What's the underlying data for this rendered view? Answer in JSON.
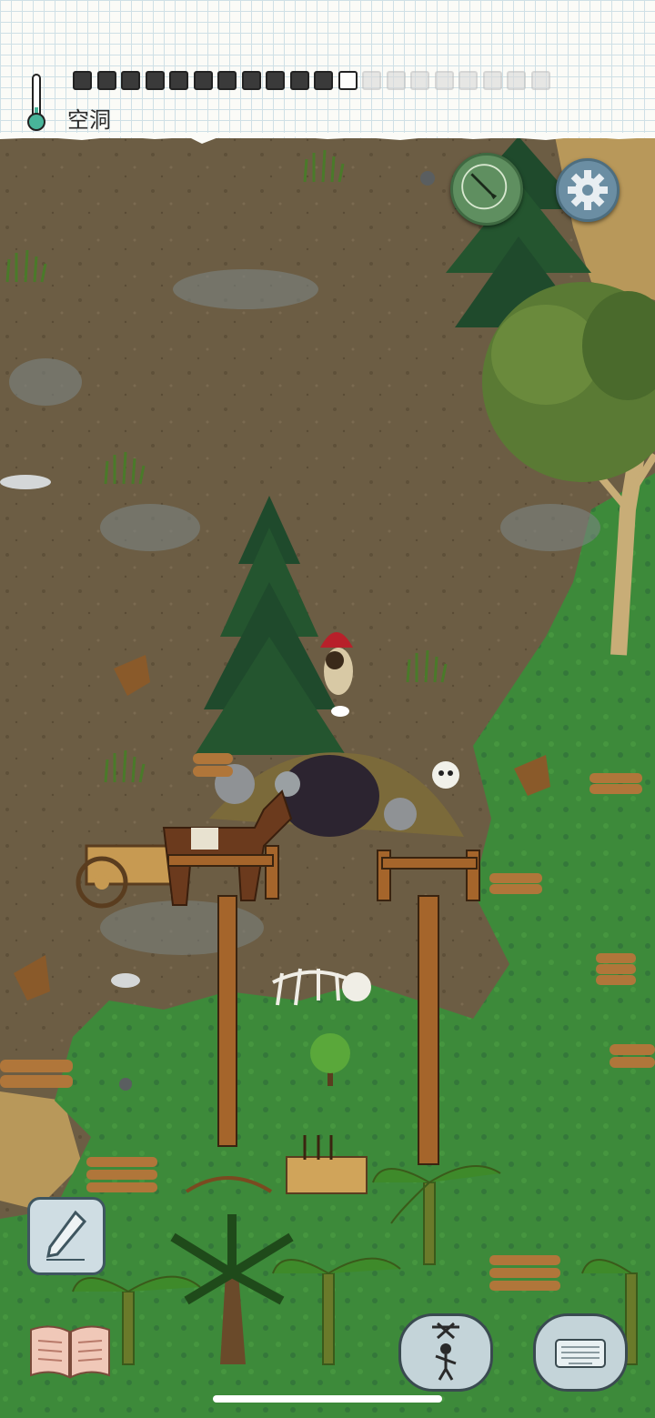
{
  "hud": {
    "status_label": "空洞",
    "hunger_pips": [
      "full",
      "full",
      "full",
      "full",
      "full",
      "full",
      "full",
      "full",
      "full",
      "full",
      "full",
      "empty",
      "faded",
      "faded",
      "faded",
      "faded",
      "faded",
      "faded",
      "faded",
      "faded"
    ],
    "temperature_level": 0.25
  },
  "buttons": {
    "compass_icon": "compass-icon",
    "settings_icon": "gear-icon",
    "note_icon": "pencil-icon",
    "tech_tree_icon": "book-icon",
    "emote_icon": "puppet-icon",
    "chat_icon": "keyboard-icon"
  },
  "colors": {
    "dirt": "#6e5f45",
    "grass": "#3f8a3c",
    "hud_paper": "#fbfbf7",
    "compass": "#5f8f60",
    "gear": "#6b8ea3",
    "bubble": "#c4d4d9"
  }
}
